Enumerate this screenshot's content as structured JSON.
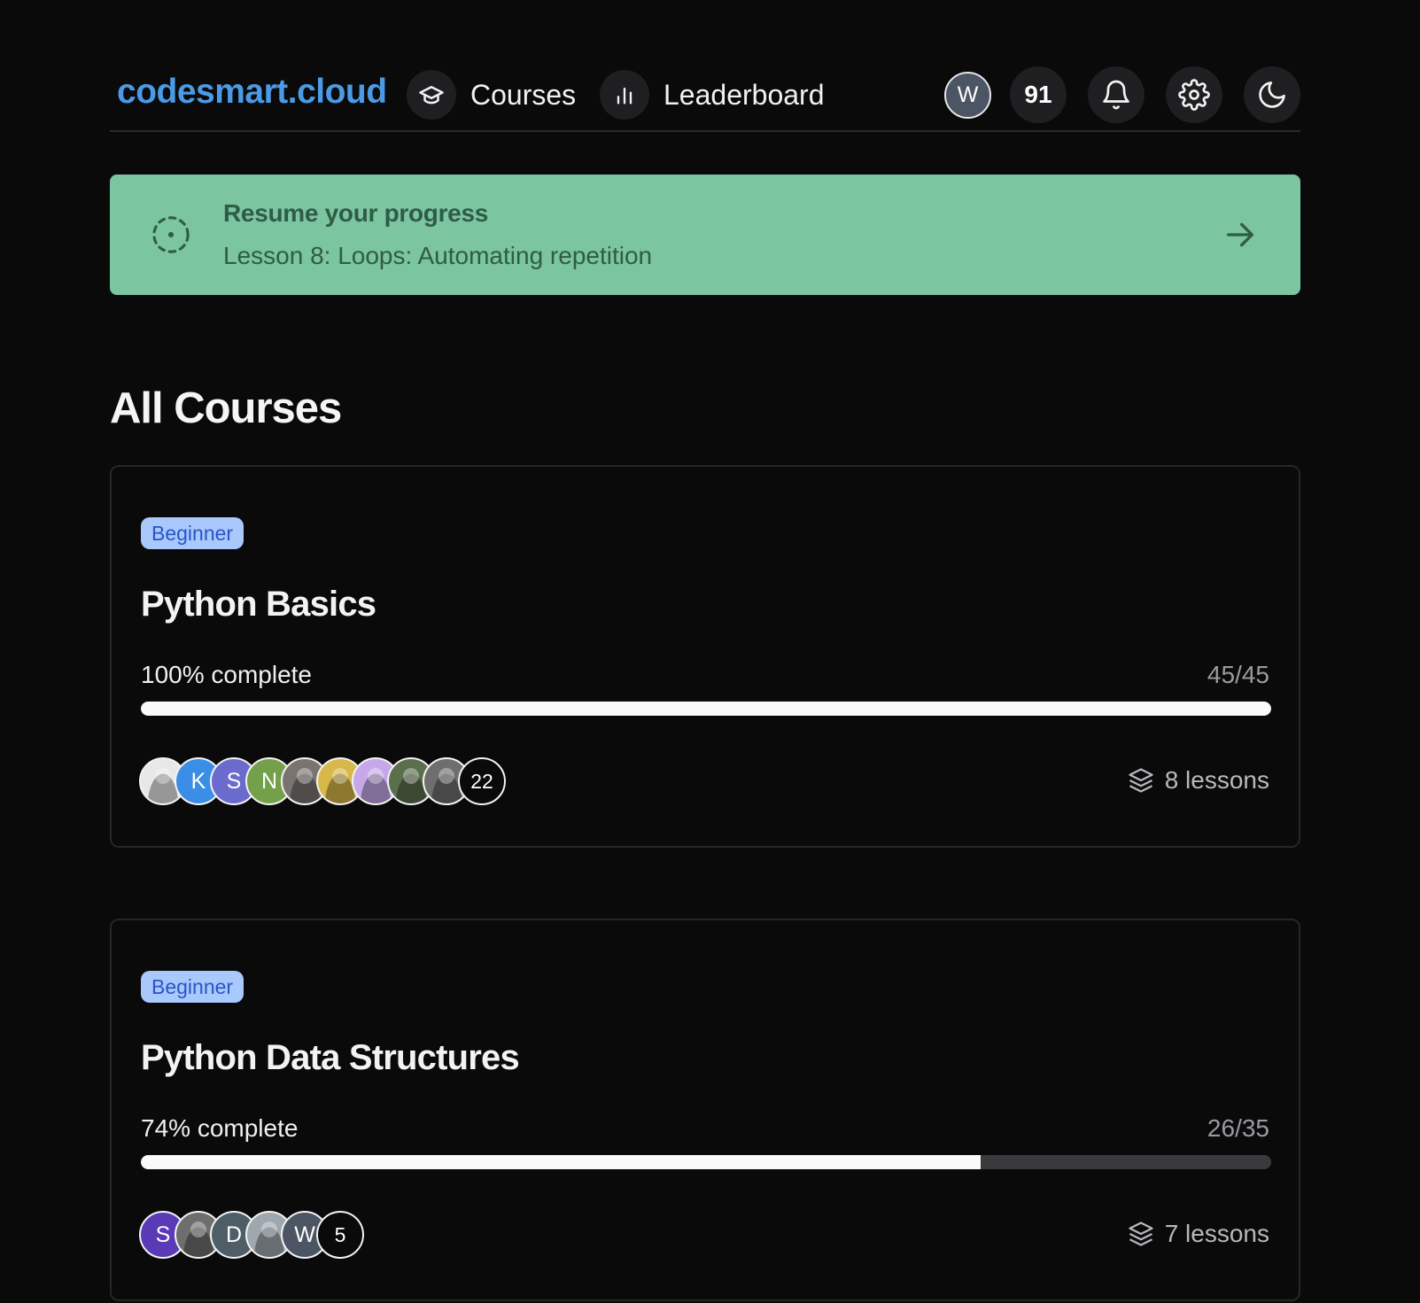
{
  "header": {
    "brand": "codesmart.cloud",
    "nav": [
      {
        "label": "Courses",
        "icon": "graduation-cap-icon"
      },
      {
        "label": "Leaderboard",
        "icon": "bar-chart-icon"
      }
    ],
    "user_initial": "W",
    "points": "91",
    "icons": [
      "bell-icon",
      "gear-icon",
      "moon-icon"
    ]
  },
  "resume": {
    "title": "Resume your progress",
    "lesson": "Lesson 8: Loops: Automating repetition",
    "icon": "dashed-circle-icon",
    "arrow": "arrow-right-icon"
  },
  "section_title": "All Courses",
  "courses": [
    {
      "level": "Beginner",
      "title": "Python Basics",
      "progress_label": "100% complete",
      "progress_count": "45/45",
      "progress_fraction": 1.0,
      "lessons": "8 lessons",
      "avatars": [
        {
          "type": "image",
          "color": "#e8e8e8",
          "name": "avatar-illustration"
        },
        {
          "type": "initial",
          "letter": "K",
          "color": "#3b8ee6"
        },
        {
          "type": "initial",
          "letter": "S",
          "color": "#6a6bcc"
        },
        {
          "type": "initial",
          "letter": "N",
          "color": "#74a04a"
        },
        {
          "type": "image",
          "color": "#7a7470",
          "name": "avatar-photo-man"
        },
        {
          "type": "image",
          "color": "#d8b84a",
          "name": "avatar-photo-art"
        },
        {
          "type": "image",
          "color": "#c6a8ea",
          "name": "avatar-identicon"
        },
        {
          "type": "image",
          "color": "#5a6f4c",
          "name": "avatar-photo-outdoor"
        },
        {
          "type": "image",
          "color": "#6e6e6e",
          "name": "avatar-photo-pattern"
        }
      ],
      "more_count": "22"
    },
    {
      "level": "Beginner",
      "title": "Python Data Structures",
      "progress_label": "74% complete",
      "progress_count": "26/35",
      "progress_fraction": 0.743,
      "lessons": "7 lessons",
      "avatars": [
        {
          "type": "initial",
          "letter": "S",
          "color": "#5b3ab8"
        },
        {
          "type": "image",
          "color": "#6e6e6e",
          "name": "avatar-photo-pattern"
        },
        {
          "type": "initial",
          "letter": "D",
          "color": "#4f5d66"
        },
        {
          "type": "image",
          "color": "#9fa8ae",
          "name": "avatar-photo-landscape"
        },
        {
          "type": "initial",
          "letter": "W",
          "color": "#4b5563"
        }
      ],
      "more_count": "5"
    }
  ]
}
